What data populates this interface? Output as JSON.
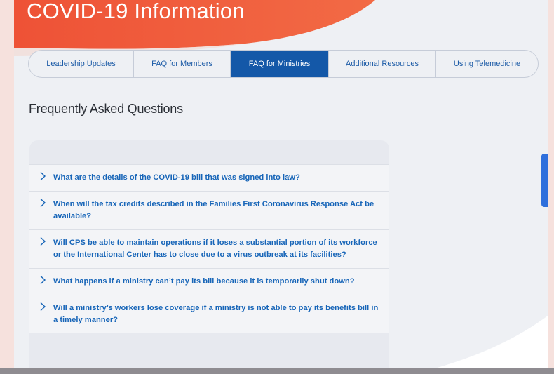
{
  "header": {
    "title": "COVID-19 Information"
  },
  "tabs": [
    {
      "label": "Leadership Updates"
    },
    {
      "label": "FAQ for Members"
    },
    {
      "label": "FAQ for Ministries"
    },
    {
      "label": "Additional Resources"
    },
    {
      "label": "Using Telemedicine"
    }
  ],
  "active_tab": "FAQ for Ministries",
  "faq": {
    "heading": "Frequently Asked Questions",
    "items": [
      {
        "question": "What are the details of the COVID-19 bill that was signed into law?"
      },
      {
        "question": "When will the tax credits described in the Families First Coronavirus Response Act be available?"
      },
      {
        "question": "Will CPS be able to maintain operations if it loses a substantial portion of its workforce or the International Center has to close due to a virus outbreak at its facilities?"
      },
      {
        "question": "What happens if a ministry can’t pay its bill because it is temporarily shut down?"
      },
      {
        "question": "Will a ministry’s workers lose coverage if a ministry is not able to pay its benefits bill in a timely manner?"
      }
    ],
    "expand_icon": "chevron-right-icon"
  },
  "colors": {
    "hero": "#f05a3c",
    "active_tab": "#1458a8",
    "link": "#1765b8",
    "panel": "#eef0f4",
    "outer_background": "#f6e1dd"
  }
}
